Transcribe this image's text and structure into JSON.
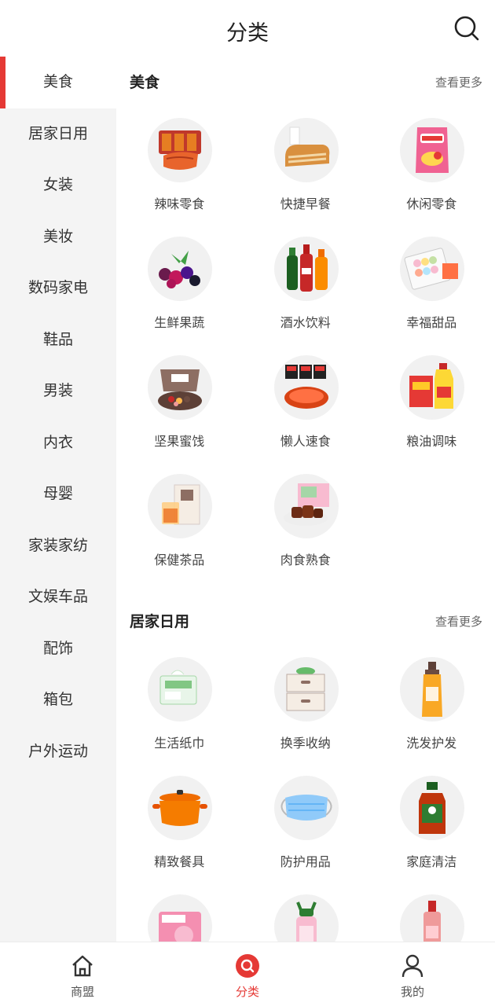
{
  "header": {
    "title": "分类",
    "search_icon": "search-icon"
  },
  "sidebar": {
    "items": [
      {
        "label": "美食",
        "active": true
      },
      {
        "label": "居家日用"
      },
      {
        "label": "女装"
      },
      {
        "label": "美妆"
      },
      {
        "label": "数码家电"
      },
      {
        "label": "鞋品"
      },
      {
        "label": "男装"
      },
      {
        "label": "内衣"
      },
      {
        "label": "母婴"
      },
      {
        "label": "家装家纺"
      },
      {
        "label": "文娱车品"
      },
      {
        "label": "配饰"
      },
      {
        "label": "箱包"
      },
      {
        "label": "户外运动"
      }
    ]
  },
  "sections": [
    {
      "title": "美食",
      "more": "查看更多",
      "items": [
        {
          "label": "辣味零食",
          "icon": "spicy-snack-icon"
        },
        {
          "label": "快捷早餐",
          "icon": "bread-icon"
        },
        {
          "label": "休闲零食",
          "icon": "chips-bag-icon"
        },
        {
          "label": "生鲜果蔬",
          "icon": "berries-icon"
        },
        {
          "label": "酒水饮料",
          "icon": "soda-bottles-icon"
        },
        {
          "label": "幸福甜品",
          "icon": "macaron-box-icon"
        },
        {
          "label": "坚果蜜饯",
          "icon": "nuts-box-icon"
        },
        {
          "label": "懒人速食",
          "icon": "instant-noodle-icon"
        },
        {
          "label": "粮油调味",
          "icon": "oil-rice-icon"
        },
        {
          "label": "保健茶品",
          "icon": "tea-box-icon"
        },
        {
          "label": "肉食熟食",
          "icon": "cooked-meat-icon"
        }
      ]
    },
    {
      "title": "居家日用",
      "more": "查看更多",
      "items": [
        {
          "label": "生活纸巾",
          "icon": "tissue-pack-icon"
        },
        {
          "label": "换季收纳",
          "icon": "storage-drawer-icon"
        },
        {
          "label": "洗发护发",
          "icon": "shampoo-bottle-icon"
        },
        {
          "label": "精致餐具",
          "icon": "cooking-pot-icon"
        },
        {
          "label": "防护用品",
          "icon": "face-mask-icon"
        },
        {
          "label": "家庭清洁",
          "icon": "disinfectant-bottle-icon"
        },
        {
          "label": "",
          "icon": "sanitary-pad-icon"
        },
        {
          "label": "",
          "icon": "kids-bottle-icon"
        },
        {
          "label": "",
          "icon": "perfume-bottle-icon"
        }
      ]
    }
  ],
  "tabbar": {
    "items": [
      {
        "label": "商盟",
        "icon": "home-icon"
      },
      {
        "label": "分类",
        "icon": "category-search-icon",
        "active": true
      },
      {
        "label": "我的",
        "icon": "user-icon"
      }
    ]
  },
  "colors": {
    "accent": "#e53935",
    "sidebar_bg": "#f4f4f4"
  }
}
